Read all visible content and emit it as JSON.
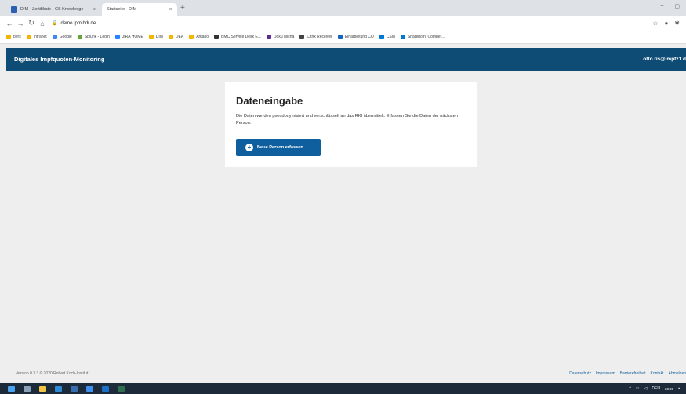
{
  "browser": {
    "tabs": [
      {
        "label": "DIM - Zertifikate - CS Knowledge",
        "active": false
      },
      {
        "label": "Startseite - DIM",
        "active": true
      }
    ],
    "url": "demo.ipm.bdr.de",
    "bookmarks": [
      {
        "label": "pers",
        "color": "#f4b400"
      },
      {
        "label": "Intranet",
        "color": "#f4b400"
      },
      {
        "label": "Google",
        "color": "#4285f4"
      },
      {
        "label": "Splunk - Login",
        "color": "#65a637"
      },
      {
        "label": "JIRA HOME",
        "color": "#2684ff"
      },
      {
        "label": "DIM",
        "color": "#f4b400"
      },
      {
        "label": "DEA",
        "color": "#f4b400"
      },
      {
        "label": "Antaño",
        "color": "#f4b400"
      },
      {
        "label": "BMC Service Desk E...",
        "color": "#333333"
      },
      {
        "label": "Doku Micha",
        "color": "#5c2d91"
      },
      {
        "label": "Citrix Receiver",
        "color": "#444444"
      },
      {
        "label": "Einarbeitung CO",
        "color": "#1565c0"
      },
      {
        "label": "CSM",
        "color": "#0078d4"
      },
      {
        "label": "Sharepoint Compet...",
        "color": "#0078d4"
      }
    ]
  },
  "app": {
    "title": "Digitales Impfquoten-Monitoring",
    "user": "otto.ris@impfz1.d"
  },
  "card": {
    "heading": "Dateneingabe",
    "text": "Die Daten werden pseudonymisiert und verschlüsselt an das RKI übermittelt. Erfassen Sie die Daten der nächsten Person.",
    "button_label": "Neue Person erfassen"
  },
  "footer": {
    "version": "Version 0.3.3 © 2020 Robert Koch-Institut",
    "links": [
      "Datenschutz",
      "Impressum",
      "Barrierefreiheit",
      "Kontakt",
      "Abmelden"
    ]
  },
  "taskbar": {
    "lang": "DEU",
    "time": "20:28"
  },
  "colors": {
    "brand": "#0f4c75",
    "button": "#0f5f9e"
  }
}
